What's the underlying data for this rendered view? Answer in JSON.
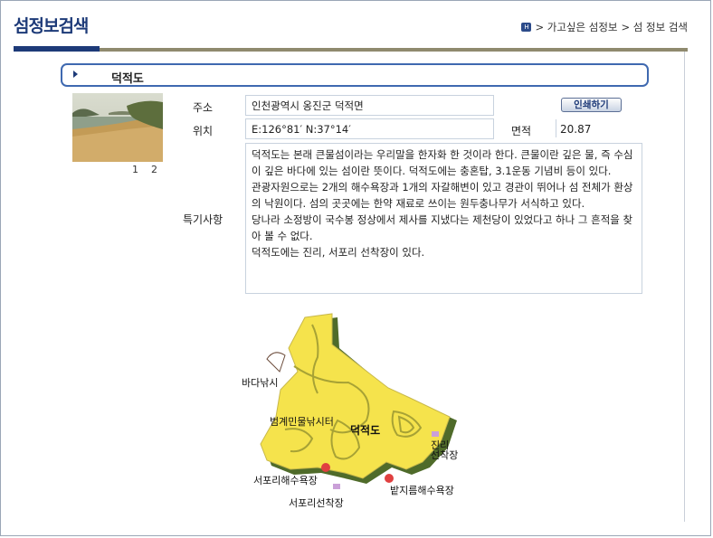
{
  "header": {
    "title": "섬정보검색",
    "breadcrumb": [
      "> 가고싶은 섬정보",
      "> 섬 정보 검색"
    ]
  },
  "island": {
    "name": "덕적도",
    "photo_pages": [
      "1",
      "2"
    ],
    "print_label": "인쇄하기",
    "fields": {
      "address_label": "주소",
      "address": "인천광역시 옹진군 덕적면",
      "location_label": "위치",
      "location": "E:126°81′ N:37°14′",
      "area_label": "면적",
      "area": "20.87",
      "notes_label": "특기사항"
    },
    "notes": [
      "덕적도는 본래 큰물섬이라는 우리말을 한자화 한 것이라 한다. 큰물이란 깊은 물, 즉 수심이 깊은 바다에 있는 섬이란 뜻이다. 덕적도에는 충혼탑, 3.1운동 기념비 등이 있다.",
      "관광자원으로는 2개의 해수욕장과 1개의 자갈해변이 있고 경관이 뛰어나 섬 전체가 환상의 낙원이다. 섬의 곳곳에는 한약 재료로 쓰이는 원두충나무가 서식하고 있다.",
      "당나라 소정방이 국수봉 정상에서 제사를 지냈다는 제천당이 있었다고 하나 그 흔적을 찾아 볼 수 없다.",
      "덕적도에는 진리, 서포리 선착장이 있다."
    ]
  },
  "map": {
    "island_label": "덕적도",
    "labels": {
      "sea_fishing": "바다낚시",
      "observatory": "범계민물낚시터",
      "jinri_dock": "진리\n선착장",
      "seopori_beach": "서포리해수욕장",
      "seopori_dock": "서포리선착장",
      "batjireum_beach": "밭지름해수욕장"
    },
    "colors": {
      "land": "#f5e34c",
      "contour": "#a7a235",
      "cliff": "#4f6b2a"
    }
  },
  "colors": {
    "title": "#1d3a78",
    "accent_line": "#1d3a78",
    "border": "#3f69b0"
  }
}
